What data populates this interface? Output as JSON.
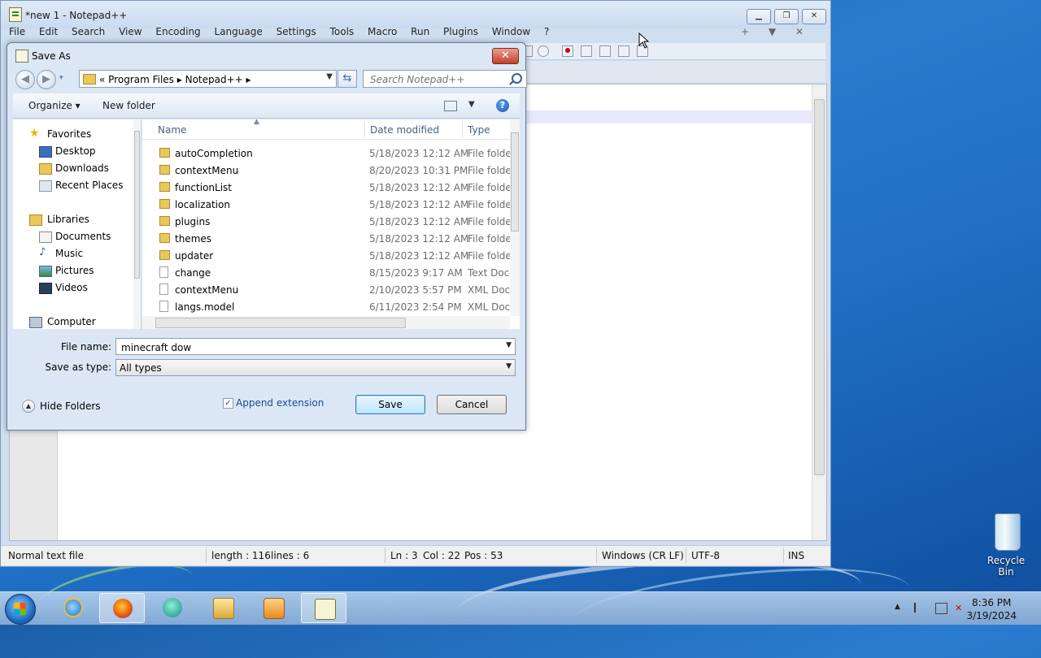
{
  "notepad": {
    "title": "*new 1 - Notepad++",
    "menu": [
      "File",
      "Edit",
      "Search",
      "View",
      "Encoding",
      "Language",
      "Settings",
      "Tools",
      "Macro",
      "Run",
      "Plugins",
      "Window",
      "?"
    ],
    "menu_right": "+ ▼ ✕",
    "status": {
      "file_type": "Normal text file",
      "length": "length : 116",
      "lines": "lines : 6",
      "ln": "Ln : 3",
      "col": "Col : 22",
      "pos": "Pos : 53",
      "eol": "Windows (CR LF)",
      "encoding": "UTF-8",
      "mode": "INS"
    }
  },
  "dialog": {
    "title": "Save As",
    "breadcrumb": "«  Program Files  ▸  Notepad++  ▸",
    "search_placeholder": "Search Notepad++",
    "organize_label": "Organize ▾",
    "new_folder_label": "New folder",
    "nav": {
      "favorites": "Favorites",
      "desktop": "Desktop",
      "downloads": "Downloads",
      "recent": "Recent Places",
      "libraries": "Libraries",
      "documents": "Documents",
      "music": "Music",
      "pictures": "Pictures",
      "videos": "Videos",
      "computer": "Computer"
    },
    "columns": {
      "name": "Name",
      "date": "Date modified",
      "type": "Type"
    },
    "files": [
      {
        "name": "autoCompletion",
        "date": "5/18/2023 12:12 AM",
        "type": "File folder"
      },
      {
        "name": "contextMenu",
        "date": "8/20/2023 10:31 PM",
        "type": "File folder"
      },
      {
        "name": "functionList",
        "date": "5/18/2023 12:12 AM",
        "type": "File folder"
      },
      {
        "name": "localization",
        "date": "5/18/2023 12:12 AM",
        "type": "File folder"
      },
      {
        "name": "plugins",
        "date": "5/18/2023 12:12 AM",
        "type": "File folder"
      },
      {
        "name": "themes",
        "date": "5/18/2023 12:12 AM",
        "type": "File folder"
      },
      {
        "name": "updater",
        "date": "5/18/2023 12:12 AM",
        "type": "File folder"
      },
      {
        "name": "change",
        "date": "8/15/2023 9:17 AM",
        "type": "Text Document"
      },
      {
        "name": "contextMenu",
        "date": "2/10/2023 5:57 PM",
        "type": "XML Document"
      },
      {
        "name": "langs.model",
        "date": "6/11/2023 2:54 PM",
        "type": "XML Document"
      }
    ],
    "file_name_label": "File name:",
    "file_name_value": "minecraft dow",
    "save_type_label": "Save as type:",
    "save_type_value": "All types",
    "hide_folders_label": "Hide Folders",
    "append_extension_label": "Append extension",
    "save_label": "Save",
    "cancel_label": "Cancel"
  },
  "taskbar": {
    "time": "8:36 PM",
    "date": "3/19/2024"
  },
  "desktop": {
    "recycle_bin_label": "Recycle Bin"
  }
}
